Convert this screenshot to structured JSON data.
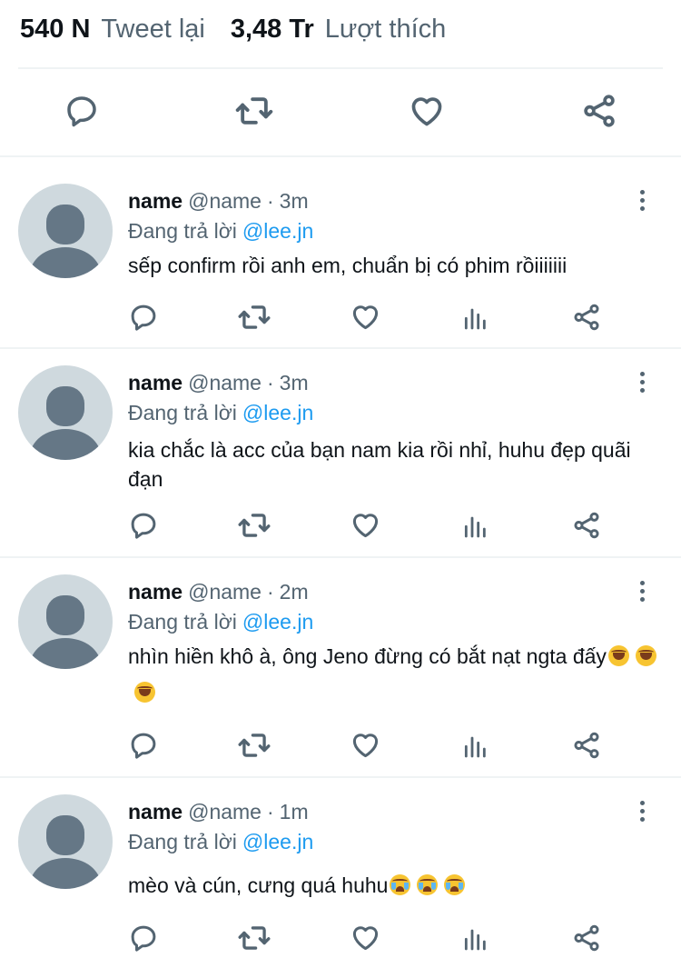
{
  "stats": {
    "retweets_count": "540 N",
    "retweets_label": "Tweet lại",
    "likes_count": "3,48 Tr",
    "likes_label": "Lượt thích"
  },
  "action_icons": [
    "reply-icon",
    "retweet-icon",
    "like-icon",
    "share-icon"
  ],
  "replies": [
    {
      "name": "name",
      "handle": "@name",
      "time": "3m",
      "replying_prefix": "Đang trả lời",
      "replying_to": "@lee.jn",
      "text": "sếp confirm rồi anh em, chuẩn bị có phim rồiiiiiii",
      "emojis": []
    },
    {
      "name": "name",
      "handle": "@name",
      "time": "3m",
      "replying_prefix": "Đang trả lời",
      "replying_to": "@lee.jn",
      "text": "kia chắc là acc của bạn nam kia rồi nhỉ, huhu đẹp quãi đạn",
      "emojis": []
    },
    {
      "name": "name",
      "handle": "@name",
      "time": "2m",
      "replying_prefix": "Đang trả lời",
      "replying_to": "@lee.jn",
      "text": "nhìn hiền khô à, ông Jeno đừng có bắt nạt ngta đấy",
      "emojis": [
        "face-with-tears-of-joy",
        "face-with-tears-of-joy",
        "face-with-tears-of-joy"
      ]
    },
    {
      "name": "name",
      "handle": "@name",
      "time": "1m",
      "replying_prefix": "Đang trả lời",
      "replying_to": "@lee.jn",
      "text": "mèo và cún, cưng quá huhu",
      "emojis": [
        "loudly-crying-face",
        "loudly-crying-face",
        "loudly-crying-face"
      ]
    }
  ],
  "colors": {
    "text": "#0f1419",
    "secondary": "#536471",
    "mention": "#1d9bf0",
    "avatar_bg": "#cfd9de",
    "avatar_fg": "#657786",
    "divider": "#eff3f4"
  }
}
